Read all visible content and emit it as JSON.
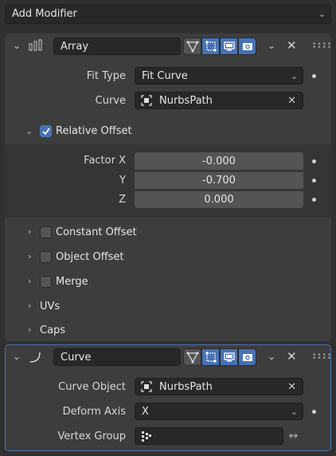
{
  "add_modifier": {
    "label": "Add Modifier"
  },
  "array": {
    "name": "Array",
    "fit_type_label": "Fit Type",
    "fit_type_value": "Fit Curve",
    "curve_label": "Curve",
    "curve_value": "NurbsPath",
    "relative_offset_label": "Relative Offset",
    "relative_offset_checked": true,
    "factor_x_label": "Factor X",
    "factor_x": "-0.000",
    "y_label": "Y",
    "factor_y": "-0.700",
    "z_label": "Z",
    "factor_z": "0.000",
    "constant_offset_label": "Constant Offset",
    "object_offset_label": "Object Offset",
    "merge_label": "Merge",
    "uvs_label": "UVs",
    "caps_label": "Caps"
  },
  "curve_mod": {
    "name": "Curve",
    "curve_object_label": "Curve Object",
    "curve_object_value": "NurbsPath",
    "deform_axis_label": "Deform Axis",
    "deform_axis_value": "X",
    "vertex_group_label": "Vertex Group",
    "vertex_group_value": ""
  },
  "colors": {
    "accent": "#4772b3",
    "panel": "#3d3d3d",
    "field": "#282828",
    "number_field": "#545454"
  }
}
